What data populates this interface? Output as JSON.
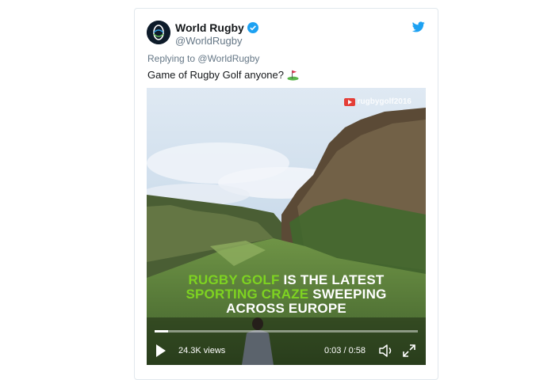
{
  "tweet": {
    "author_name": "World Rugby",
    "author_handle": "@WorldRugby",
    "replying_prefix": "Replying to",
    "replying_to": "@WorldRugby",
    "text": "Game of Rugby Golf anyone?",
    "text_emoji": "golf-flag-icon"
  },
  "video": {
    "watermark": "rugbygolf2016",
    "caption_line1_green": "RUGBY GOLF",
    "caption_line1_white": " IS THE LATEST",
    "caption_line2_green": "SPORTING CRAZE",
    "caption_line2_white": " SWEEPING",
    "caption_line3": "ACROSS EUROPE",
    "views": "24.3K views",
    "time": "0:03 / 0:58",
    "progress": 0.05
  },
  "colors": {
    "accent": "#1da1f2",
    "caption_green": "#7ed321"
  }
}
